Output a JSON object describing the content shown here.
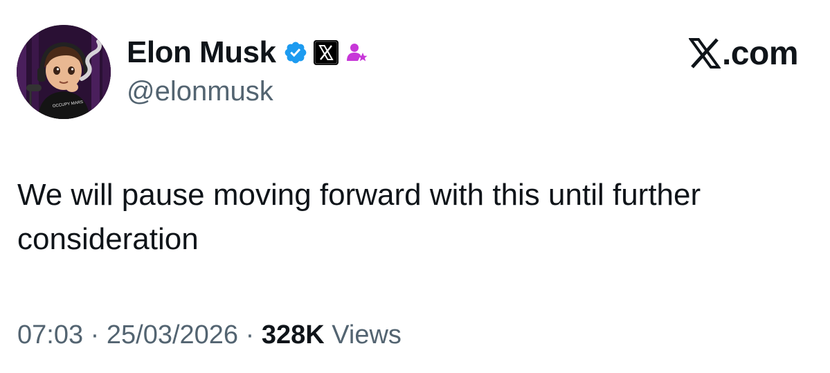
{
  "author": {
    "display_name": "Elon Musk",
    "handle": "@elonmusk",
    "avatar_shirt_text": "OCCUPY MARS"
  },
  "badges": {
    "verified_icon": "verified-checkmark-icon",
    "affiliate_icon": "x-logo-icon",
    "extra_icon": "user-star-icon",
    "verified_color": "#1d9bf0",
    "extra_color": "#c737d8"
  },
  "site": {
    "logo_icon": "x-logo-icon",
    "logo_suffix": ".com"
  },
  "tweet": {
    "text": "We will pause moving forward with this until further consideration"
  },
  "meta": {
    "time": "07:03",
    "separator": "·",
    "date": "25/03/2026",
    "views_count": "328K",
    "views_label": "Views"
  }
}
